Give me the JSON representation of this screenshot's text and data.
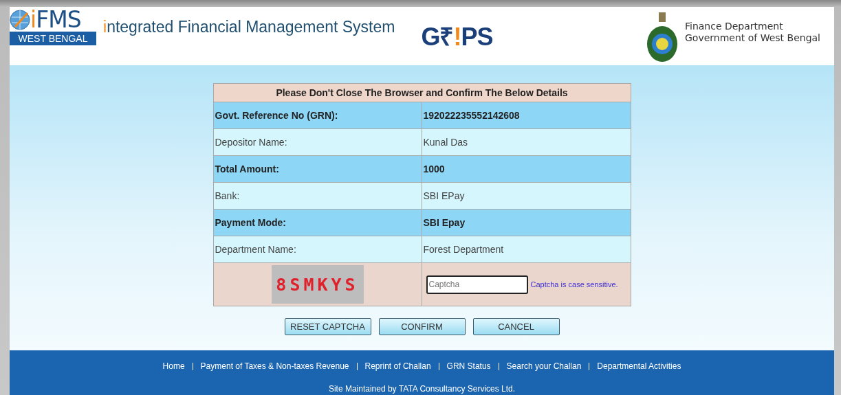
{
  "header": {
    "ifms_logo": [
      {
        "text": "i",
        "accent": true
      },
      {
        "text": "FMS",
        "accent": false
      }
    ],
    "ifms_region": "WEST BENGAL",
    "system_name": [
      {
        "text": "i",
        "accent": true
      },
      {
        "text": "ntegrated Financial Management System",
        "accent": false
      }
    ],
    "grips_logo": [
      {
        "text": "G₹",
        "accent": false
      },
      {
        "text": "!",
        "accent": true
      },
      {
        "text": "PS",
        "accent": false
      }
    ],
    "department": "Finance Department",
    "government": "Government of West Bengal"
  },
  "details": {
    "title": "Please Don't Close The Browser and Confirm The Below Details",
    "rows": [
      {
        "label": "Govt. Reference No (GRN):",
        "value": "192022235552142608",
        "bold": true
      },
      {
        "label": "Depositor Name:",
        "value": "Kunal Das",
        "bold": false
      },
      {
        "label": "Total Amount:",
        "value": "1000",
        "bold": true
      },
      {
        "label": "Bank:",
        "value": "SBI EPay",
        "bold": false
      },
      {
        "label": "Payment Mode:",
        "value": "SBI Epay",
        "bold": true
      },
      {
        "label": "Department Name:",
        "value": "Forest Department",
        "bold": false
      }
    ],
    "captcha": {
      "code": "8SMKYS",
      "placeholder": "Captcha",
      "hint": "Captcha is case sensitive."
    }
  },
  "buttons": [
    "RESET CAPTCHA",
    "CONFIRM",
    "CANCEL"
  ],
  "footer": {
    "links": [
      "Home",
      "Payment of Taxes & Non-taxes Revenue",
      "Reprint of Challan",
      "GRN Status",
      "Search your Challan",
      "Departmental Activities"
    ],
    "credit": "Site Maintained by TATA Consultancy Services Ltd."
  }
}
